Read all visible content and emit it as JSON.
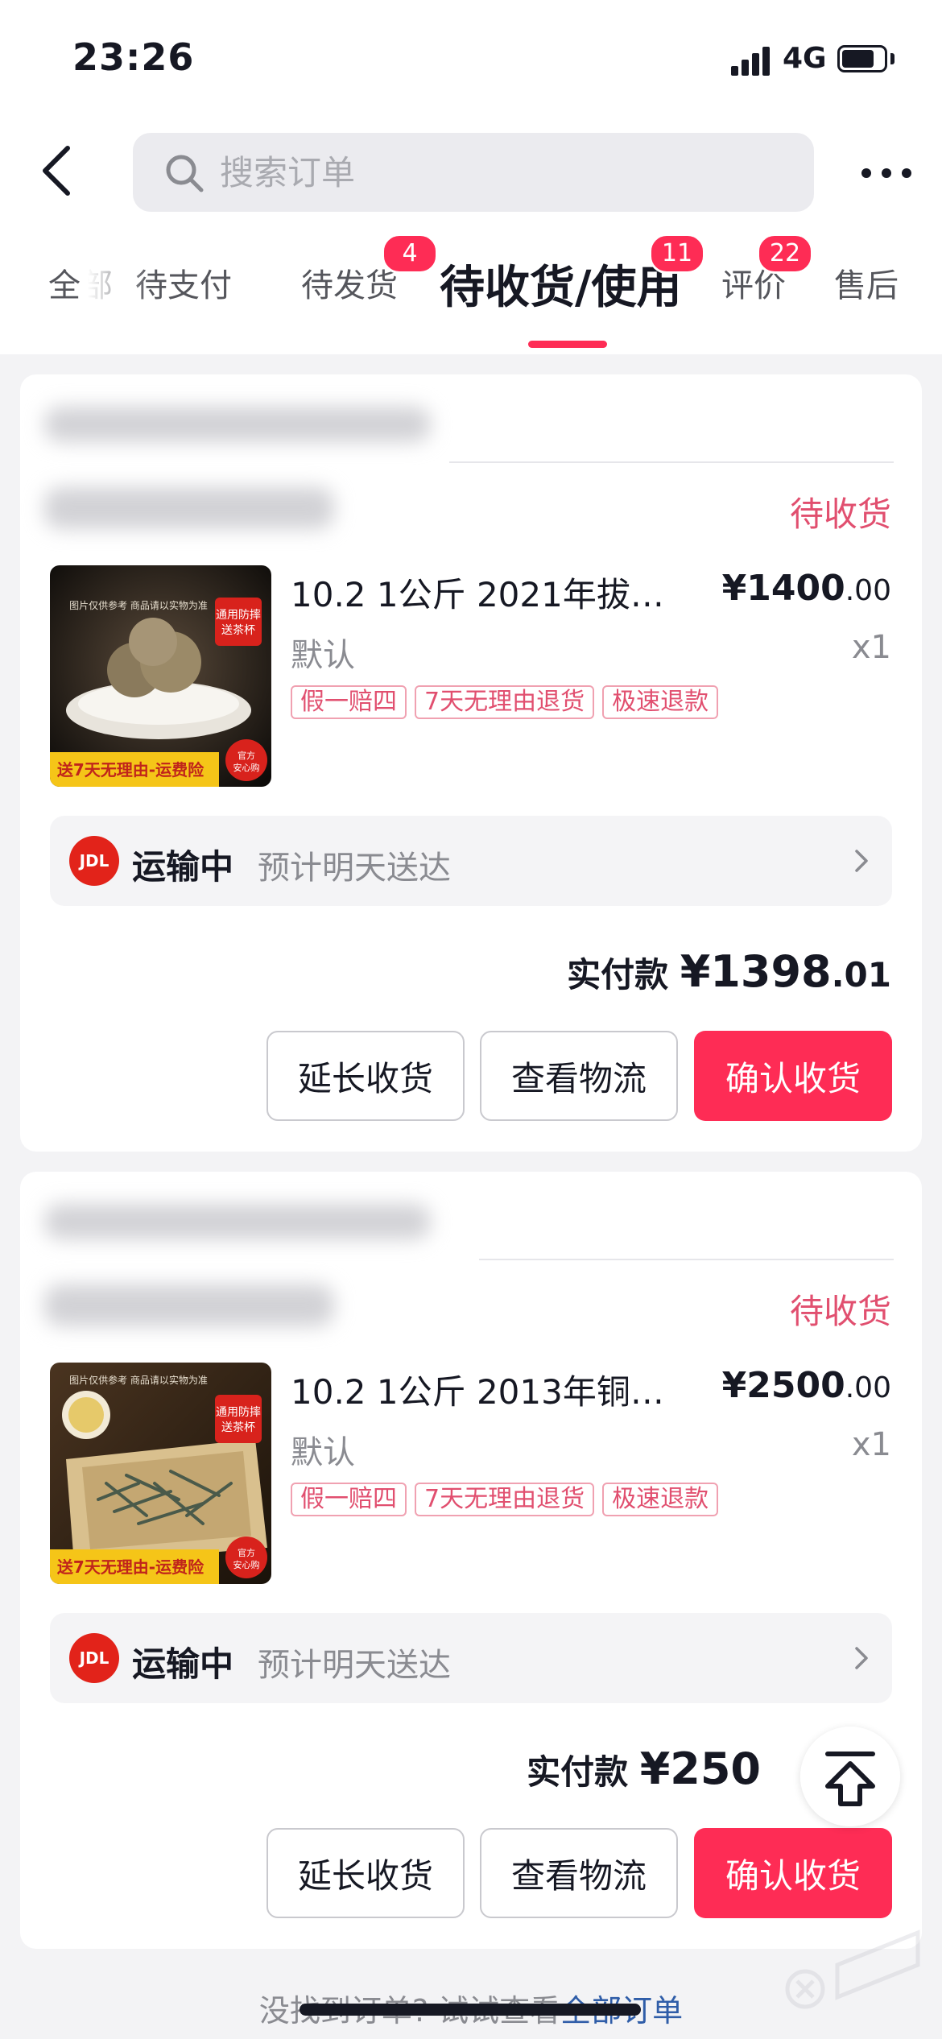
{
  "status_bar": {
    "time": "23:26",
    "network": "4G"
  },
  "search": {
    "placeholder": "搜索订单"
  },
  "tabs": [
    {
      "label": "全部"
    },
    {
      "label": "待支付"
    },
    {
      "label": "待发货",
      "badge": "4"
    },
    {
      "label": "待收货/使用",
      "badge": "11",
      "active": true
    },
    {
      "label": "评价",
      "badge": "22"
    },
    {
      "label": "售后"
    }
  ],
  "orders": [
    {
      "status": "待收货",
      "product": {
        "name": "10.2 1公斤  2021年拔…",
        "price_int": "¥1400",
        "price_dec": ".00",
        "spec": "默认",
        "qty": "x1"
      },
      "thumb": {
        "caption": "图片仅供参考 商品请以实物为准",
        "stamp": "通用防摔 送茶杯",
        "banner": "送7天无理由-运费险",
        "seal": "官方 安心购"
      },
      "tags": [
        "假一赔四",
        "7天无理由退货",
        "极速退款"
      ],
      "logistics": {
        "carrier_logo": "JDL",
        "status": "运输中",
        "eta": "预计明天送达"
      },
      "paid": {
        "label": "实付款",
        "amount": "¥1398",
        "cents": ".01"
      },
      "buttons": {
        "extend": "延长收货",
        "track": "查看物流",
        "confirm": "确认收货"
      }
    },
    {
      "status": "待收货",
      "product": {
        "name": "10.2 1公斤 2013年铜…",
        "price_int": "¥2500",
        "price_dec": ".00",
        "spec": "默认",
        "qty": "x1"
      },
      "thumb": {
        "caption": "图片仅供参考 商品请以实物为准",
        "stamp": "通用防摔 送茶杯",
        "banner": "送7天无理由-运费险",
        "seal": "官方 安心购"
      },
      "tags": [
        "假一赔四",
        "7天无理由退货",
        "极速退款"
      ],
      "logistics": {
        "carrier_logo": "JDL",
        "status": "运输中",
        "eta": "预计明天送达"
      },
      "paid": {
        "label": "实付款",
        "amount": "¥250"
      },
      "buttons": {
        "extend": "延长收货",
        "track": "查看物流",
        "confirm": "确认收货"
      }
    }
  ],
  "footer": {
    "text": "没找到订单?  试试查看",
    "link": "全部订单"
  },
  "colors": {
    "accent": "#fe2c55",
    "status_pink": "#e14f6f",
    "link_blue": "#2f5da8",
    "background": "#f3f3f5"
  }
}
